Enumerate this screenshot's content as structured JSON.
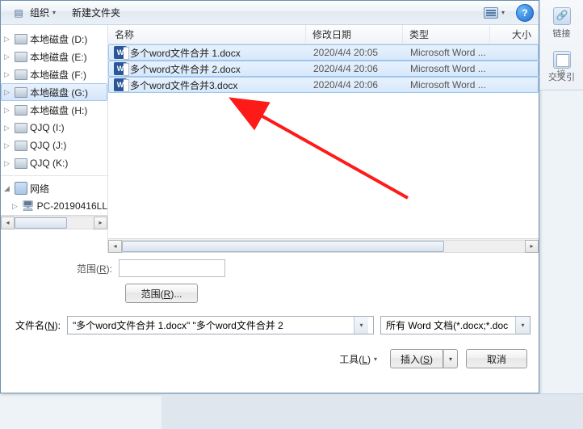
{
  "toolbar": {
    "organize": "组织",
    "new_folder": "新建文件夹"
  },
  "tree": {
    "items": [
      {
        "label": "本地磁盘 (D:)",
        "icon": "drive",
        "caret": "▷"
      },
      {
        "label": "本地磁盘 (E:)",
        "icon": "drive",
        "caret": "▷"
      },
      {
        "label": "本地磁盘 (F:)",
        "icon": "drive",
        "caret": "▷"
      },
      {
        "label": "本地磁盘 (G:)",
        "icon": "drive",
        "caret": "▷",
        "selected": true
      },
      {
        "label": "本地磁盘 (H:)",
        "icon": "drive",
        "caret": "▷"
      },
      {
        "label": "QJQ (I:)",
        "icon": "drive",
        "caret": "▷"
      },
      {
        "label": "QJQ (J:)",
        "icon": "drive",
        "caret": "▷"
      },
      {
        "label": "QJQ (K:)",
        "icon": "drive",
        "caret": "▷"
      }
    ],
    "network_label": "网络",
    "pc_label": "PC-20190416LL"
  },
  "columns": {
    "name": "名称",
    "date": "修改日期",
    "type": "类型",
    "size": "大小"
  },
  "files": [
    {
      "name": "多个word文件合并 1.docx",
      "date": "2020/4/4 20:05",
      "type": "Microsoft Word ..."
    },
    {
      "name": "多个word文件合并 2.docx",
      "date": "2020/4/4 20:06",
      "type": "Microsoft Word ..."
    },
    {
      "name": "多个word文件合并3.docx",
      "date": "2020/4/4 20:06",
      "type": "Microsoft Word ..."
    }
  ],
  "range": {
    "label": "范围(R):",
    "button": "范围(R)..."
  },
  "filename": {
    "label": "文件名(N):",
    "value": "\"多个word文件合并 1.docx\" \"多个word文件合并 2",
    "filter": "所有 Word 文档(*.docx;*.doc"
  },
  "actions": {
    "tools": "工具(L)",
    "insert": "插入(S)",
    "cancel": "取消"
  },
  "ribbon": {
    "links": "链接",
    "cross_ref": "交叉引"
  }
}
